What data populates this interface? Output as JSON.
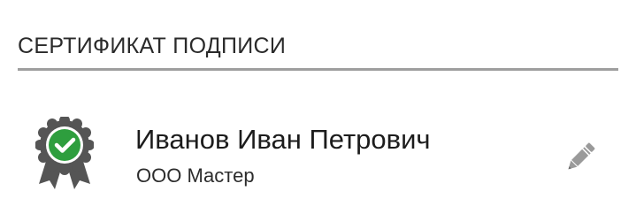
{
  "section": {
    "title": "СЕРТИФИКАТ ПОДПИСИ"
  },
  "certificate": {
    "owner_name": "Иванов Иван Петрович",
    "organization": "ООО Мастер",
    "status_icon": "verified-badge-icon",
    "edit_icon": "pencil-icon"
  },
  "colors": {
    "divider": "#9e9e9e",
    "badge_dark": "#555555",
    "badge_check": "#2e9e3e",
    "pencil": "#9a9a9a"
  }
}
